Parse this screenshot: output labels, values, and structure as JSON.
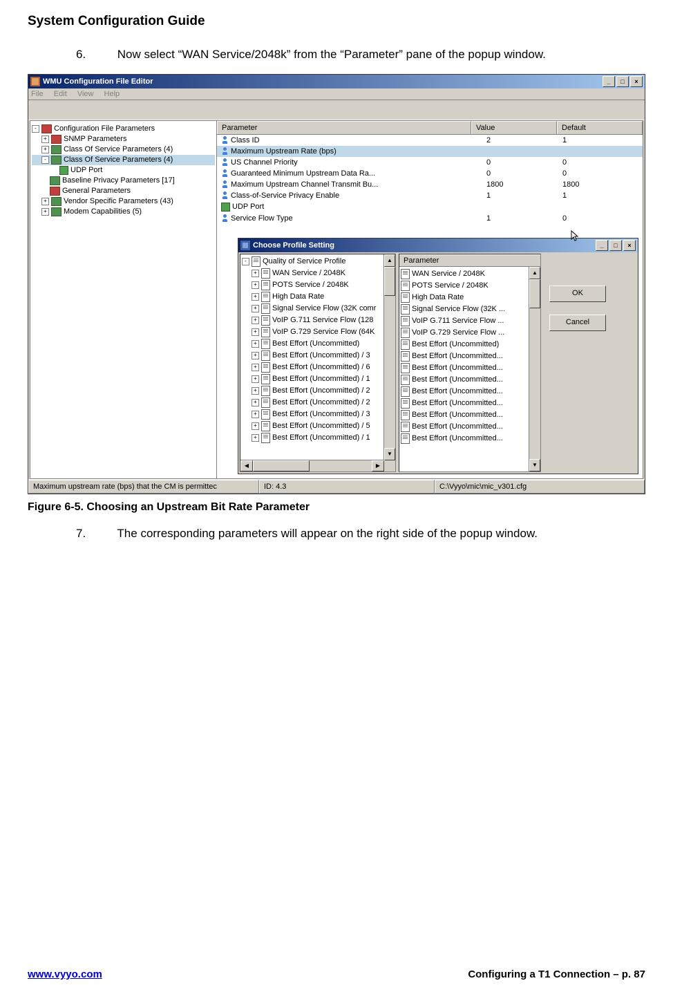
{
  "doc_title": "System Configuration Guide",
  "step6_num": "6.",
  "step6_text": "Now select “WAN Service/2048k” from the “Parameter” pane of the popup window.",
  "step7_num": "7.",
  "step7_text": "The corresponding parameters will appear on the right side of the popup window.",
  "fig_caption": "Figure 6-5. Choosing an Upstream Bit Rate Parameter",
  "footer_left": "www.vyyo.com",
  "footer_right": "Configuring a T1 Connection – p. 87",
  "outer_win": {
    "title": "WMU Configuration File Editor",
    "menu": {
      "file": "File",
      "edit": "Edit",
      "view": "View",
      "help": "Help"
    },
    "tree": [
      {
        "lvl": 0,
        "tgl": "-",
        "icon": "book-red",
        "label": "Configuration File Parameters"
      },
      {
        "lvl": 1,
        "tgl": "+",
        "icon": "book-red",
        "label": "SNMP Parameters"
      },
      {
        "lvl": 1,
        "tgl": "+",
        "icon": "book-green",
        "label": "Class Of Service Parameters (4)"
      },
      {
        "lvl": 1,
        "tgl": "-",
        "icon": "book-green",
        "label": "Class Of Service Parameters (4)",
        "sel": true
      },
      {
        "lvl": 2,
        "tgl": "",
        "icon": "green-dot",
        "label": "UDP Port"
      },
      {
        "lvl": 1,
        "tgl": "",
        "icon": "book-green",
        "label": "Baseline Privacy Parameters [17]"
      },
      {
        "lvl": 1,
        "tgl": "",
        "icon": "book-red",
        "label": "General Parameters"
      },
      {
        "lvl": 1,
        "tgl": "+",
        "icon": "book-green",
        "label": "Vendor Specific Parameters (43)"
      },
      {
        "lvl": 1,
        "tgl": "+",
        "icon": "book-green",
        "label": "Modem Capabilities (5)"
      }
    ],
    "grid_hdr": {
      "p": "Parameter",
      "v": "Value",
      "d": "Default"
    },
    "grid_rows": [
      {
        "icon": "blue",
        "p": "Class ID",
        "v": "2",
        "d": "1"
      },
      {
        "icon": "blue",
        "p": "Maximum Upstream Rate (bps)",
        "v": "",
        "d": "",
        "sel": true
      },
      {
        "icon": "blue",
        "p": "US Channel Priority",
        "v": "0",
        "d": "0"
      },
      {
        "icon": "blue",
        "p": "Guaranteed Minimum Upstream Data Ra...",
        "v": "0",
        "d": "0"
      },
      {
        "icon": "blue",
        "p": "Maximum Upstream Channel Transmit Bu...",
        "v": "1800",
        "d": "1800"
      },
      {
        "icon": "blue",
        "p": "Class-of-Service Privacy Enable",
        "v": "1",
        "d": "1"
      },
      {
        "icon": "green",
        "p": "UDP Port",
        "v": "",
        "d": ""
      },
      {
        "icon": "blue",
        "p": "Service Flow Type",
        "v": "1",
        "d": "0"
      }
    ],
    "status": {
      "s1": "Maximum upstream rate (bps) that the CM is permittec",
      "s2": "ID: 4.3",
      "s3": "C:\\Vyyo\\mic\\mic_v301.cfg"
    }
  },
  "inner_win": {
    "title": "Choose Profile Setting",
    "list_hdr": "Parameter",
    "tree": [
      {
        "lvl": 0,
        "tgl": "-",
        "icon": "doc",
        "label": "Quality of Service Profile"
      },
      {
        "lvl": 1,
        "tgl": "+",
        "icon": "doc",
        "label": "WAN Service / 2048K"
      },
      {
        "lvl": 1,
        "tgl": "+",
        "icon": "doc",
        "label": "POTS Service / 2048K"
      },
      {
        "lvl": 1,
        "tgl": "+",
        "icon": "doc",
        "label": "High Data Rate"
      },
      {
        "lvl": 1,
        "tgl": "+",
        "icon": "doc",
        "label": "Signal Service Flow (32K comr"
      },
      {
        "lvl": 1,
        "tgl": "+",
        "icon": "doc",
        "label": "VoIP G.711 Service Flow (128"
      },
      {
        "lvl": 1,
        "tgl": "+",
        "icon": "doc",
        "label": "VoIP G.729 Service Flow (64K"
      },
      {
        "lvl": 1,
        "tgl": "+",
        "icon": "doc",
        "label": "Best Effort (Uncommitted)"
      },
      {
        "lvl": 1,
        "tgl": "+",
        "icon": "doc",
        "label": "Best Effort (Uncommitted) / 3"
      },
      {
        "lvl": 1,
        "tgl": "+",
        "icon": "doc",
        "label": "Best Effort (Uncommitted) / 6"
      },
      {
        "lvl": 1,
        "tgl": "+",
        "icon": "doc",
        "label": "Best Effort (Uncommitted) / 1"
      },
      {
        "lvl": 1,
        "tgl": "+",
        "icon": "doc",
        "label": "Best Effort (Uncommitted) / 2"
      },
      {
        "lvl": 1,
        "tgl": "+",
        "icon": "doc",
        "label": "Best Effort (Uncommitted) / 2"
      },
      {
        "lvl": 1,
        "tgl": "+",
        "icon": "doc",
        "label": "Best Effort (Uncommitted) / 3"
      },
      {
        "lvl": 1,
        "tgl": "+",
        "icon": "doc",
        "label": "Best Effort (Uncommitted) / 5"
      },
      {
        "lvl": 1,
        "tgl": "+",
        "icon": "doc",
        "label": "Best Effort (Uncommitted) / 1"
      }
    ],
    "list": [
      "WAN Service / 2048K",
      "POTS Service / 2048K",
      "High Data Rate",
      "Signal Service Flow (32K ...",
      "VoIP G.711 Service Flow ...",
      "VoIP G.729 Service Flow ...",
      "Best Effort (Uncommitted)",
      "Best Effort (Uncommitted...",
      "Best Effort (Uncommitted...",
      "Best Effort (Uncommitted...",
      "Best Effort (Uncommitted...",
      "Best Effort (Uncommitted...",
      "Best Effort (Uncommitted...",
      "Best Effort (Uncommitted...",
      "Best Effort (Uncommitted..."
    ],
    "ok": "OK",
    "cancel": "Cancel"
  }
}
